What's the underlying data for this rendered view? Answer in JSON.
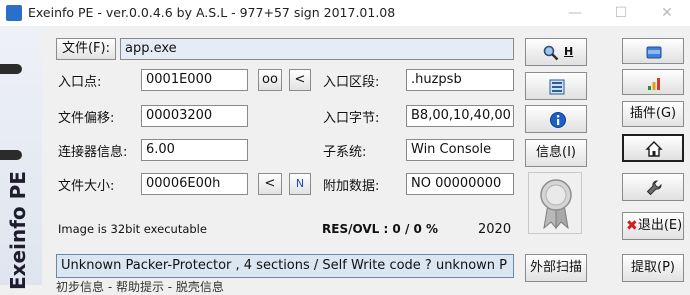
{
  "window": {
    "title": "Exeinfo PE - ver.0.0.4.6  by A.S.L -  977+57 sign  2017.01.08"
  },
  "sidebar": {
    "brand": "Exeinfo PE"
  },
  "file": {
    "button_label": "文件(F):",
    "value": "app.exe"
  },
  "fields": {
    "entry_point": {
      "label": "入口点:",
      "value": "0001E000",
      "btn_oo": "oo",
      "btn_lt": "<"
    },
    "entry_section": {
      "label": "入口区段:",
      "value": ".huzpsb"
    },
    "file_offset": {
      "label": "文件偏移:",
      "value": "00003200"
    },
    "entry_bytes": {
      "label": "入口字节:",
      "value": "B8,00,10,40,00"
    },
    "linker_info": {
      "label": "连接器信息:",
      "value": "6.00"
    },
    "subsystem": {
      "label": "子系统:",
      "value": "Win Console"
    },
    "file_size": {
      "label": "文件大小:",
      "value": "00006E00h",
      "btn_lt": "<",
      "btn_n": "N"
    },
    "overlay": {
      "label": "附加数据:",
      "value": "NO    00000000"
    }
  },
  "info": {
    "image_bits": "Image is 32bit executable",
    "res_ovl": "RES/OVL : 0 / 0 %",
    "year": "2020"
  },
  "status_line": "Unknown Packer-Protector , 4 sections  / Self Write code ? unknown P",
  "bottom_partial": "初步信息 - 帮助提示 - 脱壳信息",
  "center_buttons": {
    "search_h": "H",
    "info_label": "信息(I)",
    "external_scan": "外部扫描"
  },
  "right_buttons": {
    "plugins": "插件(G)",
    "exit": "退出(E)",
    "extract": "提取(P)"
  },
  "icons": [
    "magnifier-icon",
    "list-icon",
    "info-icon",
    "ribbon-award-icon",
    "folder-icon",
    "signal-bars-icon",
    "home-icon",
    "wrench-icon",
    "red-x-icon"
  ]
}
